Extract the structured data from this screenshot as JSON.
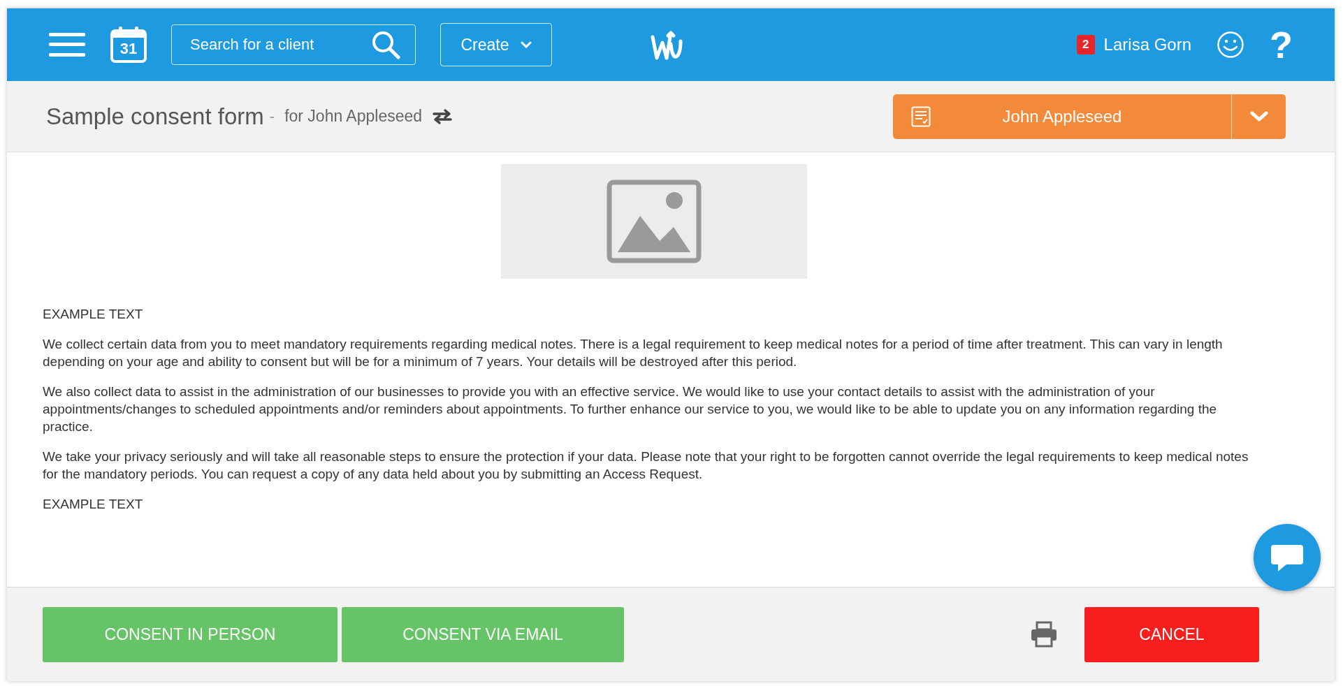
{
  "header": {
    "search": {
      "placeholder": "Search for a client"
    },
    "create_button": "Create",
    "calendar_day": "31",
    "notification_count": "2",
    "user_name": "Larisa Gorn",
    "help": "?"
  },
  "title_bar": {
    "title": "Sample consent form",
    "separator": "-",
    "subtitle": "for John Appleseed",
    "client_button": "John Appleseed"
  },
  "content": {
    "paragraphs": [
      {
        "text": "EXAMPLE TEXT"
      },
      {
        "text": "We collect certain data from you to meet mandatory requirements regarding medical notes. There is a legal requirement to keep medical notes for a period of time after treatment. This can vary in length depending on your age and ability to consent but will be for a minimum of 7 years. Your details will be destroyed after this period."
      },
      {
        "text": "We also collect data to assist in the administration of our businesses to provide you with an effective service. We would like to use your contact details to assist with the administration of your appointments/changes to scheduled appointments and/or reminders about appointments. To further enhance our service to you, we would like to be able to update you on any information regarding the practice."
      },
      {
        "text": "We take your privacy seriously and will take all reasonable steps to ensure the protection if your data. Please note that your right to be forgotten cannot override the legal requirements to keep medical notes for the mandatory periods. You can request a copy of any data held about you by submitting an Access Request."
      },
      {
        "text": "EXAMPLE TEXT"
      }
    ]
  },
  "footer": {
    "buttons": [
      {
        "label": "CONSENT IN PERSON",
        "kind": "consent"
      },
      {
        "label": "CONSENT VIA EMAIL",
        "kind": "consent"
      },
      {
        "label": "CANCEL",
        "kind": "cancel"
      }
    ]
  }
}
